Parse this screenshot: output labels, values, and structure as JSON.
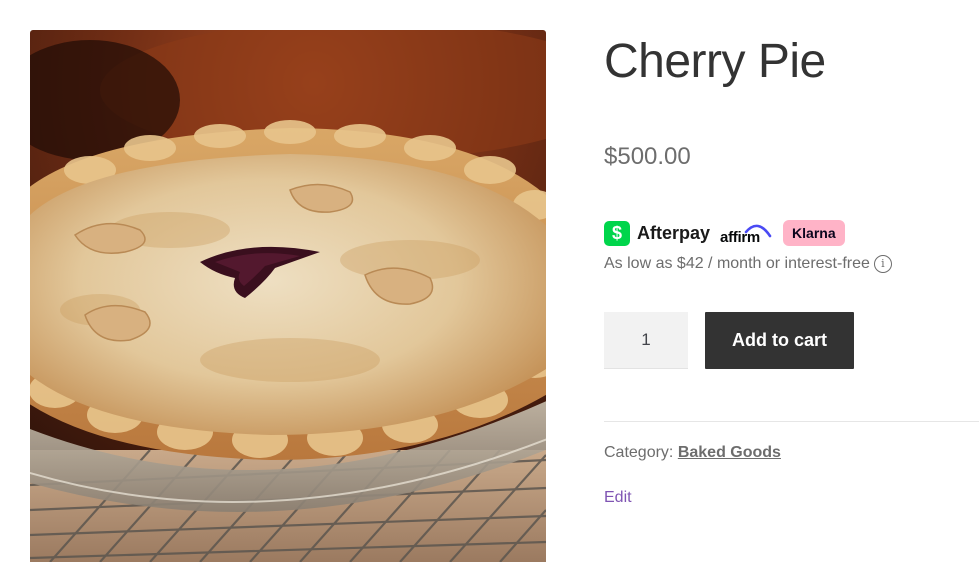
{
  "product": {
    "title": "Cherry Pie",
    "price": "$500.00",
    "image_alt": "Cherry pie on a cooling rack"
  },
  "payments": {
    "cashapp_glyph": "$",
    "afterpay_label": "Afterpay",
    "affirm_label": "affirm",
    "klarna_label": "Klarna",
    "installment_text": "As low as $42 / month or interest-free",
    "info_glyph": "i",
    "colors": {
      "afterpay_green": "#00d54b",
      "affirm_blue": "#4a4af4",
      "klarna_pink": "#ffb3c7"
    }
  },
  "cart": {
    "quantity_value": "1",
    "add_to_cart_label": "Add to cart"
  },
  "meta": {
    "category_label": "Category:",
    "category_value": "Baked Goods"
  },
  "admin": {
    "edit_label": "Edit"
  },
  "colors": {
    "button_bg": "#333333",
    "link_purple": "#7f54b3",
    "muted_text": "#6d6d6d"
  }
}
